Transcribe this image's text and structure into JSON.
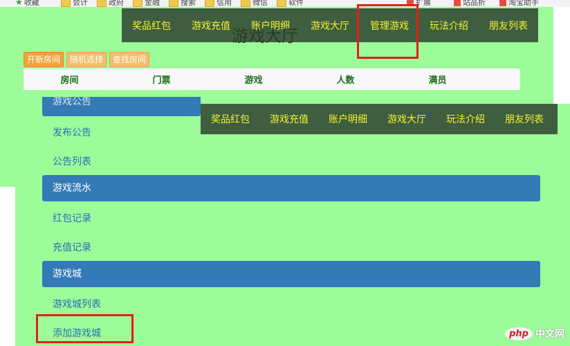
{
  "bookmarks": [
    {
      "label": "收藏",
      "icon": "star-icon"
    },
    {
      "label": "会计",
      "icon": "folder-icon"
    },
    {
      "label": "政府",
      "icon": "folder-icon"
    },
    {
      "label": "金融",
      "icon": "folder-icon"
    },
    {
      "label": "搜索",
      "icon": "folder-icon"
    },
    {
      "label": "信用",
      "icon": "folder-icon"
    },
    {
      "label": "微信",
      "icon": "folder-icon"
    },
    {
      "label": "软件",
      "icon": "folder-icon"
    },
    {
      "label": "扩展",
      "icon": "ext-icon"
    },
    {
      "label": "站品折",
      "icon": "ext-icon"
    },
    {
      "label": "淘宝助手",
      "icon": "ext-icon"
    }
  ],
  "top_nav": {
    "items": [
      "奖品红包",
      "游戏充值",
      "账户明细",
      "游戏大厅",
      "管理游戏",
      "玩法介绍",
      "朋友列表"
    ]
  },
  "second_nav": {
    "items": [
      "奖品红包",
      "游戏充值",
      "账户明细",
      "游戏大厅",
      "玩法介绍",
      "朋友列表"
    ]
  },
  "lobby_title": "游戏大厅",
  "room_actions": {
    "open_room": "开新房间",
    "random_pick": "随机选择",
    "find_room": "查找房间"
  },
  "room_table": {
    "columns": [
      "房间",
      "门票",
      "游戏",
      "人数",
      "满员"
    ]
  },
  "sidebar": {
    "partial_heading": "游戏公告",
    "groups": [
      {
        "heading": "游戏流水",
        "links": [
          "红包记录",
          "充值记录"
        ]
      },
      {
        "heading": "游戏城",
        "links": [
          "游戏城列表",
          "添加游戏城"
        ]
      }
    ],
    "announce_links": [
      "发布公告",
      "公告列表"
    ]
  },
  "watermark": {
    "logo": "php",
    "text": "中文网"
  },
  "colors": {
    "background_green": "#9cfc99",
    "navbar": "#3f5e3f",
    "nav_text": "#f3f330",
    "panel_blue": "#337ab7",
    "link_blue": "#2a6fb5",
    "orange": "#f0a43a",
    "highlight_red": "#e0201a"
  }
}
